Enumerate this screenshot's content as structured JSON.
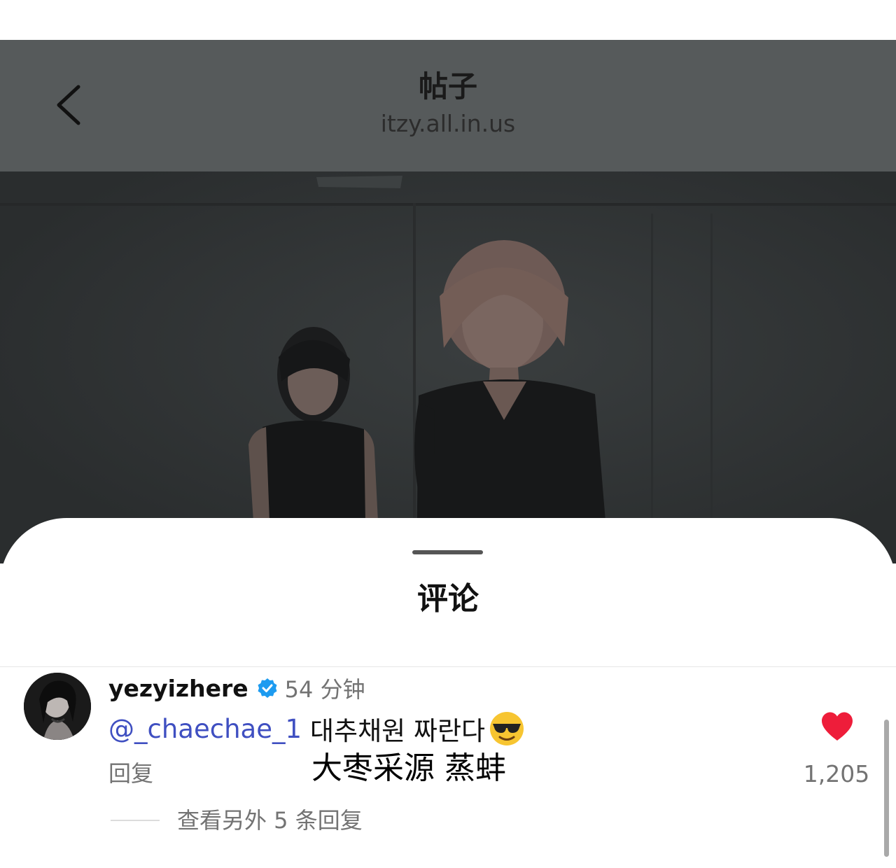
{
  "header": {
    "title": "帖子",
    "subtitle": "itzy.all.in.us",
    "back_icon": "chevron-left-icon"
  },
  "colors": {
    "header_dim": "#565a5b",
    "sheet_bg": "#ffffff",
    "mention": "#3f4fc1",
    "like_heart": "#ee1d3a",
    "verified_badge": "#1d9bf0",
    "secondary_text": "#737373"
  },
  "comments_sheet": {
    "title": "评论",
    "comment": {
      "avatar_icon": "user-avatar",
      "username": "yezyizhere",
      "verified_icon": "verified-badge-icon",
      "time": "54 分钟",
      "mention": "@_chaechae_1",
      "text": "대추채원 짜란다",
      "emoji_icon": "sunglasses-emoji",
      "reply_label": "回复",
      "like_icon": "heart-filled-icon",
      "like_count": "1,205",
      "view_replies": "查看另外 5 条回复"
    }
  },
  "overlay_caption": "大枣采源 蒸蚌"
}
